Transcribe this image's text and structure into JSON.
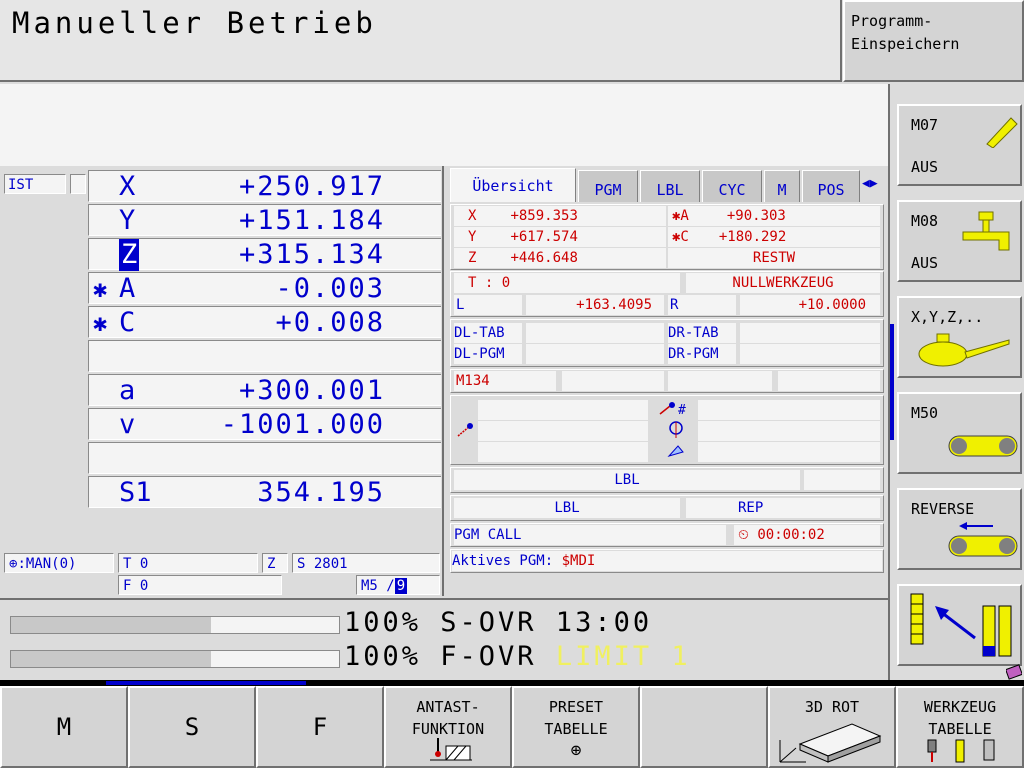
{
  "title": "Manueller Betrieb",
  "top_softkey": {
    "line1": "Programm-",
    "line2": "Einspeichern"
  },
  "positions": {
    "label": "IST",
    "rows": [
      {
        "prefix": "",
        "axis": "X",
        "value": "+250.917"
      },
      {
        "prefix": "",
        "axis": "Y",
        "value": "+151.184"
      },
      {
        "prefix": "",
        "axis": "Z",
        "value": "+315.134"
      },
      {
        "prefix": "✱",
        "axis": "A",
        "value": "-0.003"
      },
      {
        "prefix": "✱",
        "axis": "C",
        "value": "+0.008"
      },
      {
        "prefix": "",
        "axis": "",
        "value": ""
      },
      {
        "prefix": "",
        "axis": "a",
        "value": "+300.001"
      },
      {
        "prefix": "",
        "axis": "v",
        "value": "-1001.000"
      },
      {
        "prefix": "",
        "axis": "",
        "value": ""
      },
      {
        "prefix": "",
        "axis": "S1",
        "value": "354.195"
      }
    ]
  },
  "status_bar": {
    "datum": ":MAN(0)",
    "tool": "T 0",
    "axis": "Z",
    "spindle": "S 2801",
    "feed": "F 0",
    "m_funcs": "M5 /",
    "m_active": "9"
  },
  "tabs": [
    "Übersicht",
    "PGM",
    "LBL",
    "CYC",
    "M",
    "POS"
  ],
  "tab_arrows": "◀▶",
  "overview": {
    "coords": [
      {
        "axis": "X",
        "value": "+859.353"
      },
      {
        "axis": "Y",
        "value": "+617.574"
      },
      {
        "axis": "Z",
        "value": "+446.648"
      }
    ],
    "rot_coords": [
      {
        "axis": "✱A",
        "value": "+90.303"
      },
      {
        "axis": "✱C",
        "value": "+180.292"
      }
    ],
    "restw": "RESTW",
    "tool_label": "T : 0",
    "tool_name": "NULLWERKZEUG",
    "l_label": "L",
    "l_value": "+163.4095",
    "r_label": "R",
    "r_value": "+10.0000",
    "dl_tab": "DL-TAB",
    "dr_tab": "DR-TAB",
    "dl_pgm": "DL-PGM",
    "dr_pgm": "DR-PGM",
    "m134": "M134",
    "lbl1": "LBL",
    "lbl2": "LBL",
    "rep": "REP",
    "pgm_call": "PGM CALL",
    "time": "00:00:02",
    "active_pgm_label": "Aktives PGM:",
    "active_pgm": "$MDI"
  },
  "override": {
    "s_line": "100% S-OVR 13:00",
    "f_line_left": "100% F-OVR ",
    "f_line_limit": "LIMIT 1",
    "s_fill": 0.61,
    "f_fill": 0.61
  },
  "vertical_softkeys": [
    {
      "top": "M07",
      "bottom": "AUS"
    },
    {
      "top": "M08",
      "bottom": "AUS"
    },
    {
      "top": "X,Y,Z,..",
      "bottom": ""
    },
    {
      "top": "M50",
      "bottom": ""
    },
    {
      "top": "REVERSE",
      "bottom": ""
    }
  ],
  "horizontal_softkeys": [
    {
      "label": "M"
    },
    {
      "label": "S"
    },
    {
      "label": "F"
    },
    {
      "label": "ANTAST-\nFUNKTION"
    },
    {
      "label": "PRESET\nTABELLE"
    },
    {
      "label": ""
    },
    {
      "label": "3D ROT"
    },
    {
      "label": "WERKZEUG\nTABELLE"
    }
  ],
  "colors": {
    "accent_blue": "#0000cc",
    "alert_red": "#cc0000",
    "limit_yellow": "#f0f060",
    "icon_yellow": "#f0f000"
  }
}
